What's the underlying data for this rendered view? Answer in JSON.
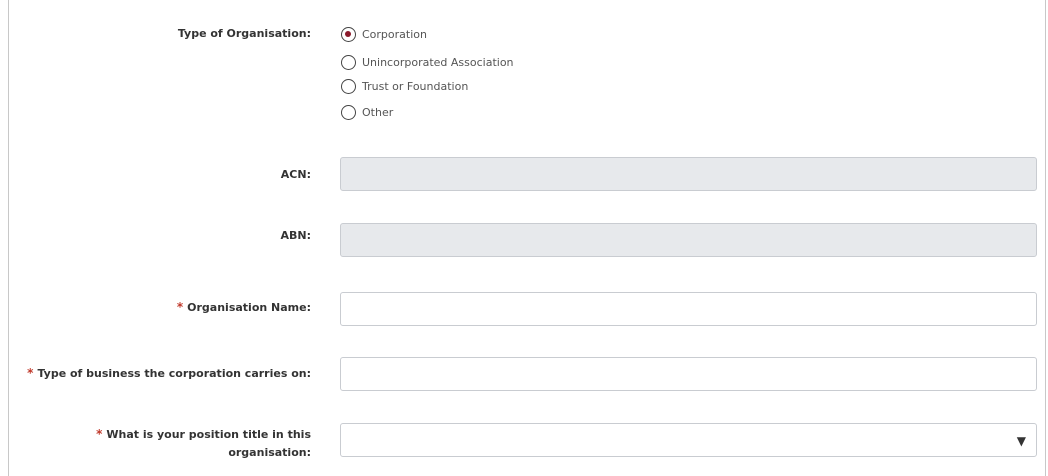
{
  "org_type": {
    "label": "Type of Organisation:",
    "options": [
      {
        "label": "Corporation",
        "checked": true
      },
      {
        "label": "Unincorporated Association",
        "checked": false
      },
      {
        "label": "Trust or Foundation",
        "checked": false
      },
      {
        "label": "Other",
        "checked": false
      }
    ]
  },
  "acn": {
    "label": "ACN:",
    "value": ""
  },
  "abn": {
    "label": "ABN:",
    "value": ""
  },
  "org_name": {
    "label": "Organisation Name:",
    "required": "*",
    "value": ""
  },
  "business_type": {
    "label": "Type of business the corporation carries on:",
    "required": "*",
    "value": ""
  },
  "position": {
    "label_line1": "What is your position title in this",
    "label_line2": "organisation:",
    "required": "*",
    "selected": "",
    "arrow": "▼"
  },
  "colors": {
    "accent": "#8b1a2b",
    "required": "#c0392b",
    "disabled_bg": "#e7e9ec"
  }
}
